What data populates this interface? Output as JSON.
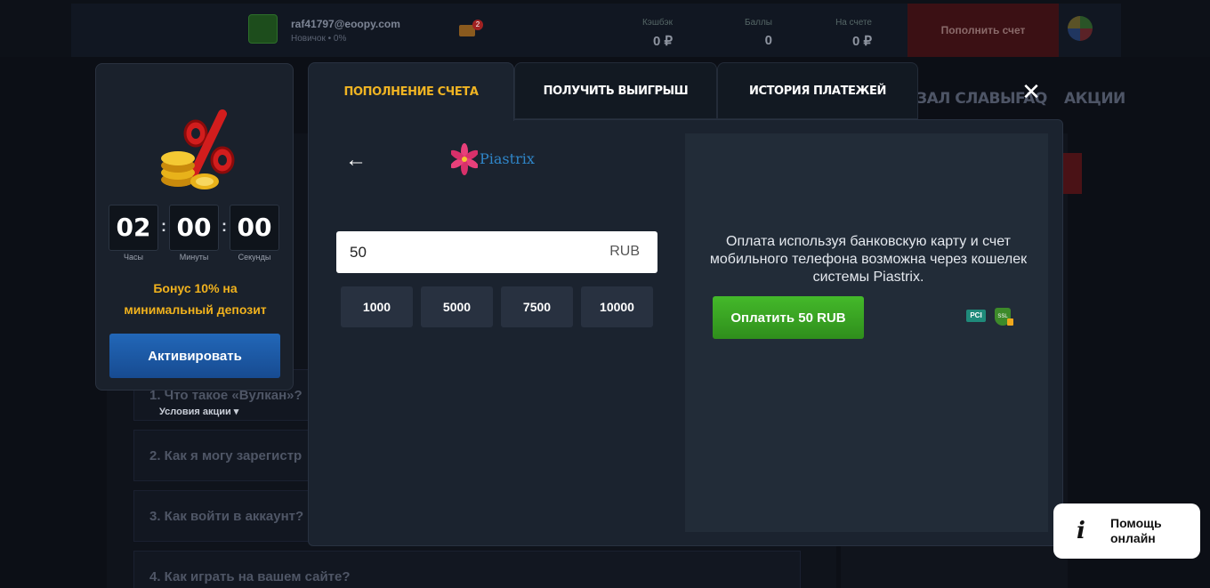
{
  "header": {
    "email": "raf41797@eoopy.com",
    "level": "Новичок • 0%",
    "mail_badge": "2",
    "stats": [
      {
        "label": "Кэшбэк",
        "value": "0 ₽"
      },
      {
        "label": "Баллы",
        "value": "0"
      },
      {
        "label": "На счете",
        "value": "0 ₽"
      }
    ],
    "deposit_label": "Пополнить счет"
  },
  "nav": {
    "items": [
      "ЗАЛ СЛАВЫ",
      "FAQ",
      "АКЦИИ"
    ]
  },
  "faq": {
    "items": [
      "1. Что такое «Вулкан»?",
      "2. Как я могу зарегистр",
      "3. Как войти в аккаунт?",
      "4. Как играть на вашем сайте?"
    ],
    "promo_terms": "Условия акции ▾"
  },
  "bonus": {
    "timer": {
      "hours": "02",
      "minutes": "00",
      "seconds": "00"
    },
    "labels": {
      "hours": "Часы",
      "minutes": "Минуты",
      "seconds": "Секунды"
    },
    "text_line1": "Бонус 10% на",
    "text_line2": "минимальный депозит",
    "activate_label": "Активировать"
  },
  "modal": {
    "tabs": [
      "ПОПОЛНЕНИЕ СЧЕТА",
      "ПОЛУЧИТЬ ВЫИГРЫШ",
      "ИСТОРИЯ ПЛАТЕЖЕЙ"
    ],
    "close": "✕",
    "back": "←",
    "provider": "Piastrix",
    "amount": "50",
    "currency": "RUB",
    "presets": [
      "1000",
      "5000",
      "7500",
      "10000"
    ],
    "info": "Оплата используя банковскую карту и счет мобильного телефона возможна через кошелек системы Piastrix.",
    "pay_label": "Оплатить 50 RUB",
    "badges": {
      "pci": "PCI",
      "ssl": "SSL"
    }
  },
  "help": {
    "icon": "i",
    "text": "Помощь онлайн"
  },
  "colors": {
    "accent_gold": "#f0b423",
    "activate_blue": "#2267b8",
    "pay_green": "#44b92a"
  }
}
